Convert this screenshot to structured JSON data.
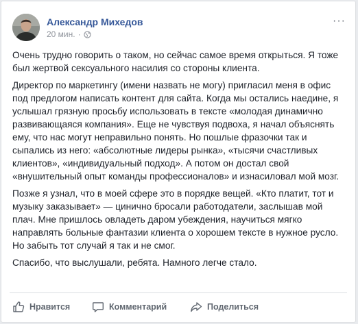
{
  "post": {
    "author_name": "Александр Михедов",
    "timestamp": "20 мин.",
    "separator": "·",
    "privacy_icon": "globe-icon",
    "more_icon_text": "···",
    "paragraphs": [
      "Очень трудно говорить о таком, но сейчас самое время открыться. Я тоже был жертвой сексуального насилия со стороны клиента.",
      "Директор по маркетингу (имени назвать не могу) пригласил меня в офис под предлогом написать контент для сайта. Когда мы остались наедине, я услышал грязную просьбу использовать в тексте «молодая динамично развивающаяся компания». Еще не чувствуя подвоха, я начал объяснять ему, что нас могут неправильно понять. Но пошлые фразочки так и сыпались из него: «абсолютные лидеры рынка», «тысячи счастливых клиентов», «индивидуальный подход». А потом он достал свой «внушительный опыт команды профессионалов» и изнасиловал мой мозг.",
      "Позже я узнал, что в моей сфере это в порядке вещей. «Кто платит, тот и музыку заказывает» — цинично бросали работодатели, заслышав мой плач. Мне пришлось овладеть даром убеждения, научиться мягко направлять больные фантазии клиента о хорошем тексте в нужное русло. Но забыть тот случай я так и не смог.",
      "Спасибо, что выслушали, ребята. Намного легче стало."
    ]
  },
  "actions": {
    "like_label": "Нравится",
    "comment_label": "Комментарий",
    "share_label": "Поделиться"
  },
  "colors": {
    "author": "#365899",
    "meta": "#90949c",
    "action": "#606770"
  }
}
